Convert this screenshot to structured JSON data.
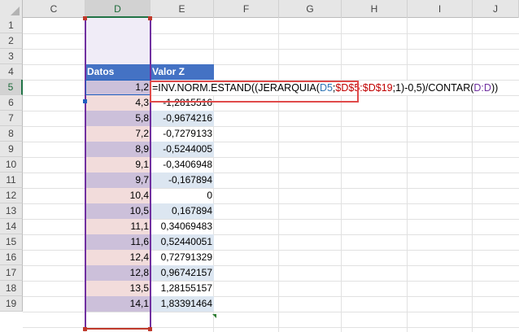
{
  "columns": [
    "C",
    "D",
    "E",
    "F",
    "G",
    "H",
    "I",
    "J"
  ],
  "selected_column": "D",
  "rows": [
    "1",
    "2",
    "3",
    "4",
    "5",
    "6",
    "7",
    "8",
    "9",
    "10",
    "11",
    "12",
    "13",
    "14",
    "15",
    "16",
    "17",
    "18",
    "19"
  ],
  "selected_row": "5",
  "table": {
    "header_d": "Datos",
    "header_e": "Valor Z",
    "d_values": [
      "1,2",
      "4,3",
      "5,8",
      "7,2",
      "8,9",
      "9,1",
      "9,7",
      "10,4",
      "10,5",
      "11,1",
      "11,6",
      "12,4",
      "12,8",
      "13,5",
      "14,1"
    ],
    "e_values": [
      "",
      "-1,2815516",
      "-0,9674216",
      "-0,7279133",
      "-0,5244005",
      "-0,3406948",
      "-0,167894",
      "0",
      "0,167894",
      "0,34069483",
      "0,52440051",
      "0,72791329",
      "0,96742157",
      "1,28155157",
      "1,83391464"
    ]
  },
  "formula_parts": {
    "p1": "=INV.NORM.ESTAND(",
    "p2": "(JERARQUIA(",
    "p3": "D5",
    "p4": ";",
    "p5": "$D$5:$D$19",
    "p6": ";1)-0,5)",
    "p7": "/CONTAR(",
    "p8": "D:D",
    "p9": "))"
  },
  "colors": {
    "header_blue": "#4472c4",
    "range_purple": "#7030a0",
    "ref_blue": "#2e75b6",
    "ref_red": "#c00000",
    "highlight_red": "#e04a4a",
    "excel_green": "#217346"
  }
}
